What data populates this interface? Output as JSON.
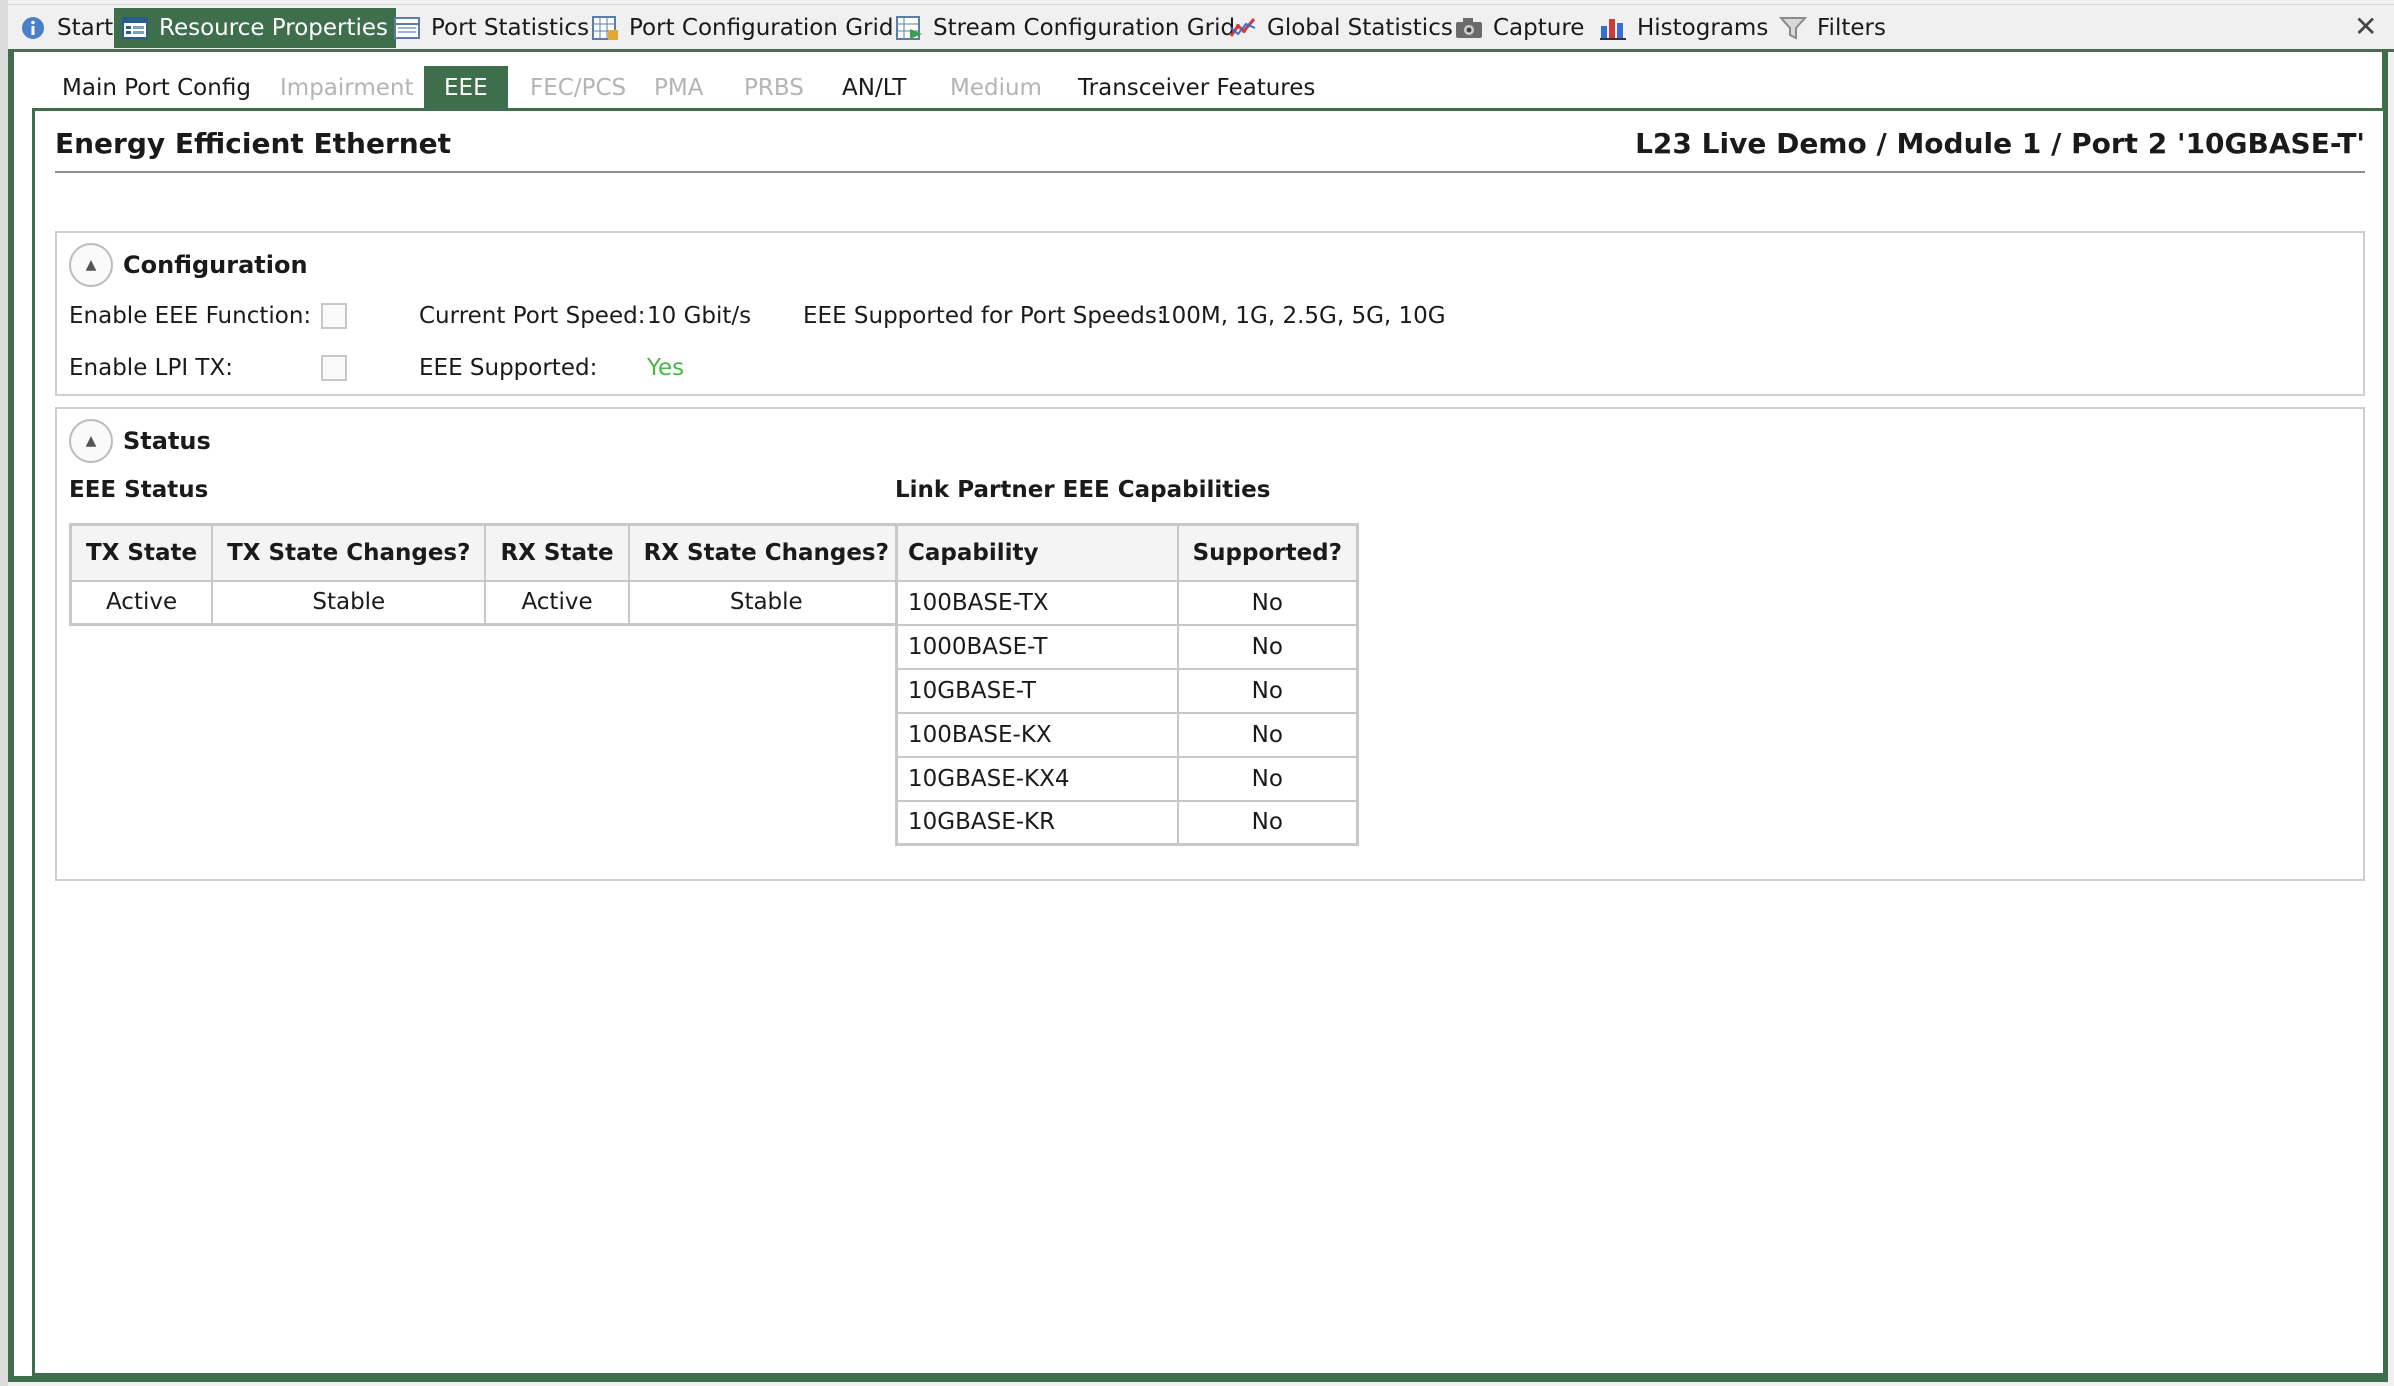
{
  "top_tabs": [
    {
      "label": "Start",
      "icon": "info-icon"
    },
    {
      "label": "Resource Properties",
      "icon": "properties-icon"
    },
    {
      "label": "Port Statistics",
      "icon": "table-icon"
    },
    {
      "label": "Port Configuration Grid",
      "icon": "grid-icon"
    },
    {
      "label": "Stream Configuration Grid",
      "icon": "stream-grid-icon"
    },
    {
      "label": "Global Statistics",
      "icon": "line-chart-icon"
    },
    {
      "label": "Capture",
      "icon": "camera-icon"
    },
    {
      "label": "Histograms",
      "icon": "bar-chart-icon"
    },
    {
      "label": "Filters",
      "icon": "funnel-icon"
    }
  ],
  "close_glyph": "✕",
  "sub_tabs": [
    {
      "label": "Main Port Config"
    },
    {
      "label": "Impairment"
    },
    {
      "label": "EEE"
    },
    {
      "label": "FEC/PCS"
    },
    {
      "label": "PMA"
    },
    {
      "label": "PRBS"
    },
    {
      "label": "AN/LT"
    },
    {
      "label": "Medium"
    },
    {
      "label": "Transceiver Features"
    }
  ],
  "page": {
    "title": "Energy Efficient Ethernet",
    "port_path": "L23 Live Demo / Module 1 / Port 2 '10GBASE-T'"
  },
  "configuration": {
    "title": "Configuration",
    "enable_eee_label": "Enable EEE Function:",
    "enable_eee_checked": false,
    "enable_lpi_label": "Enable LPI TX:",
    "enable_lpi_checked": false,
    "current_speed_label": "Current Port Speed:",
    "current_speed_value": "10 Gbit/s",
    "eee_supported_label": "EEE Supported:",
    "eee_supported_value": "Yes",
    "eee_speeds_label": "EEE Supported for Port Speeds:",
    "eee_speeds_value": "100M, 1G, 2.5G, 5G, 10G",
    "colors": {
      "yes": "#48b54a"
    }
  },
  "status": {
    "title": "Status",
    "eee_status_title": "EEE Status",
    "eee_status_headers": [
      "TX State",
      "TX State Changes?",
      "RX State",
      "RX State Changes?"
    ],
    "eee_status_row": [
      "Active",
      "Stable",
      "Active",
      "Stable"
    ],
    "lp_title": "Link Partner EEE Capabilities",
    "lp_headers": [
      "Capability",
      "Supported?"
    ],
    "lp_rows": [
      [
        "100BASE-TX",
        "No"
      ],
      [
        "1000BASE-T",
        "No"
      ],
      [
        "10GBASE-T",
        "No"
      ],
      [
        "100BASE-KX",
        "No"
      ],
      [
        "10GBASE-KX4",
        "No"
      ],
      [
        "10GBASE-KR",
        "No"
      ]
    ]
  },
  "theme": {
    "accent": "#3e6e4c"
  }
}
